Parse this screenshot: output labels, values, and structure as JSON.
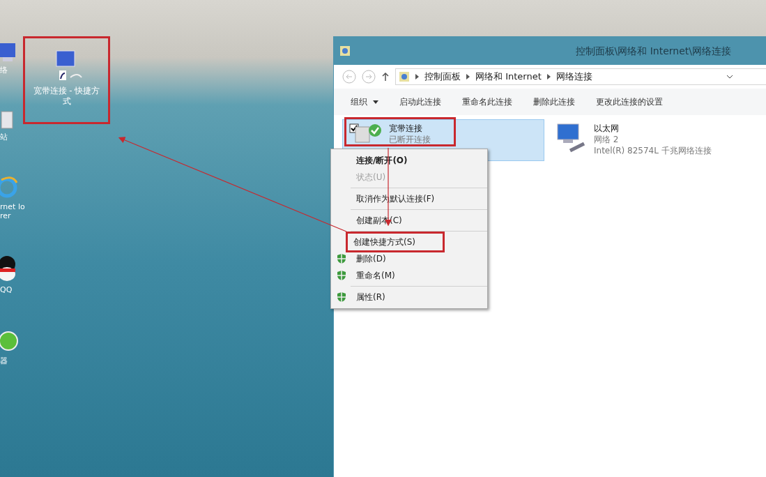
{
  "desktop": {
    "icons": [
      {
        "label": "络",
        "kind": "network"
      },
      {
        "label": "站",
        "kind": "bin"
      },
      {
        "label": "rnet lorer",
        "kind": "browser"
      },
      {
        "label": "QQ",
        "kind": "penguin"
      },
      {
        "label": "器",
        "kind": "globe"
      }
    ],
    "shortcut": {
      "label": "宽带连接 - 快捷方式",
      "highlighted": true
    }
  },
  "window": {
    "title": "控制面板\\网络和 Internet\\网络连接",
    "breadcrumb": [
      "控制面板",
      "网络和 Internet",
      "网络连接"
    ],
    "toolbar": [
      {
        "label": "组织",
        "dropdown": true
      },
      {
        "label": "启动此连接",
        "dropdown": false
      },
      {
        "label": "重命名此连接",
        "dropdown": false
      },
      {
        "label": "删除此连接",
        "dropdown": false
      },
      {
        "label": "更改此连接的设置",
        "dropdown": false
      }
    ],
    "connections": [
      {
        "name": "宽带连接",
        "lines": [
          "已断开连接"
        ],
        "selected": true,
        "highlighted": true,
        "kind": "broadband"
      },
      {
        "name": "以太网",
        "lines": [
          "网络 2",
          "Intel(R) 82574L 千兆网络连接"
        ],
        "selected": false,
        "highlighted": false,
        "kind": "ethernet"
      }
    ]
  },
  "context_menu": {
    "items": [
      {
        "kind": "item",
        "label": "连接/断开(O)",
        "bold": true,
        "disabled": false,
        "shield": false,
        "highlighted": false
      },
      {
        "kind": "item",
        "label": "状态(U)",
        "bold": false,
        "disabled": true,
        "shield": false,
        "highlighted": false
      },
      {
        "kind": "separator"
      },
      {
        "kind": "item",
        "label": "取消作为默认连接(F)",
        "bold": false,
        "disabled": false,
        "shield": false,
        "highlighted": false
      },
      {
        "kind": "separator"
      },
      {
        "kind": "item",
        "label": "创建副本(C)",
        "bold": false,
        "disabled": false,
        "shield": false,
        "highlighted": false
      },
      {
        "kind": "separator"
      },
      {
        "kind": "item",
        "label": "创建快捷方式(S)",
        "bold": false,
        "disabled": false,
        "shield": false,
        "highlighted": true
      },
      {
        "kind": "item",
        "label": "删除(D)",
        "bold": false,
        "disabled": false,
        "shield": true,
        "highlighted": false
      },
      {
        "kind": "item",
        "label": "重命名(M)",
        "bold": false,
        "disabled": false,
        "shield": true,
        "highlighted": false
      },
      {
        "kind": "separator"
      },
      {
        "kind": "item",
        "label": "属性(R)",
        "bold": false,
        "disabled": false,
        "shield": true,
        "highlighted": false
      }
    ]
  }
}
